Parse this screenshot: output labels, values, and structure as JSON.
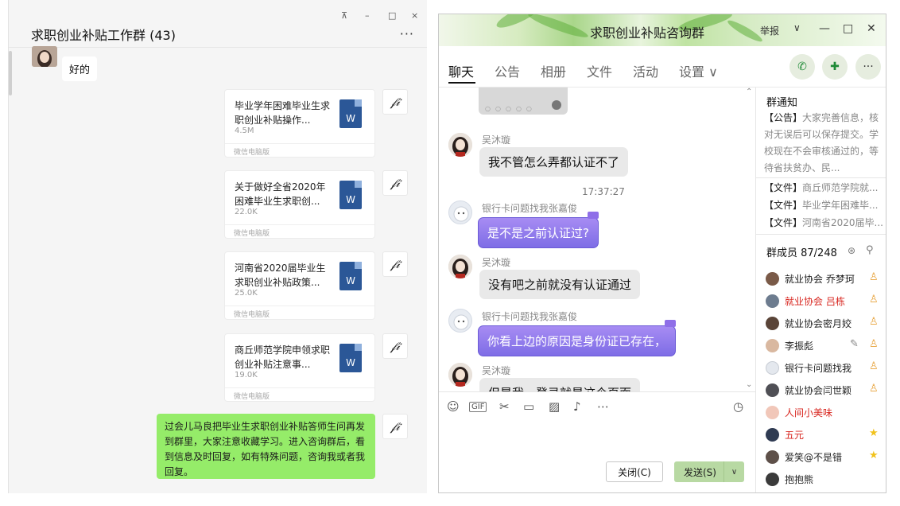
{
  "wechat": {
    "title": "求职创业补贴工作群 (43)",
    "controls": {
      "pin": "⊼",
      "minimize": "–",
      "maximize": "□",
      "close": "×"
    },
    "more": "···",
    "incoming_text": "好的",
    "files": [
      {
        "title": "毕业学年困难毕业生求职创业补贴操作...",
        "size": "4.5M",
        "source": "微信电脑版"
      },
      {
        "title": "关于做好全省2020年困难毕业生求职创...",
        "size": "22.0K",
        "source": "微信电脑版"
      },
      {
        "title": "河南省2020届毕业生求职创业补贴政策...",
        "size": "25.0K",
        "source": "微信电脑版"
      },
      {
        "title": "商丘师范学院申领求职创业补贴注意事...",
        "size": "19.0K",
        "source": "微信电脑版"
      }
    ],
    "word_icon_letter": "W",
    "avatar_glyph": "𝒻𝒾",
    "outgoing_text": "过会儿马良把毕业生求职创业补贴答师生问再发到群里，大家注意收藏学习。进入咨询群后，看到信息及时回复，如有特殊问题，咨询我或者我回复。"
  },
  "qq": {
    "title": "求职创业补贴咨询群",
    "title_controls": {
      "report": "举报",
      "dropdown": "∨",
      "minimize": "—",
      "maximize": "□",
      "close": "✕"
    },
    "tabs": [
      "聊天",
      "公告",
      "相册",
      "文件",
      "活动",
      "设置 ∨"
    ],
    "circle_buttons": {
      "call": "✆",
      "add": "✚",
      "more": "···"
    },
    "time": "17:37:27",
    "messages": [
      {
        "name": "吴沐璇",
        "text": "我不管怎么弄都认证不了"
      },
      {
        "name": "银行卡问题找我张嘉俊",
        "text": "是不是之前认证过?"
      },
      {
        "name": "吴沐璇",
        "text": "没有吧之前就没有认证通过"
      },
      {
        "name": "银行卡问题找我张嘉俊",
        "text": "你看上边的原因是身份证已存在，"
      },
      {
        "name": "吴沐璇",
        "text": "但是我一登录就是这个页面"
      }
    ],
    "toolbar_icons": [
      "☺",
      "GIF",
      "✂",
      "▭",
      "▨",
      "♪",
      "⋯",
      "◷"
    ],
    "close_label": "关闭(C)",
    "send_label": "发送(S)",
    "send_dropdown": "∨",
    "notice_header": "群通知",
    "notice_tag": "【公告】",
    "notice_text": "大家完善信息，核对无误后可以保存提交。学校现在不会审核通过的，等待省扶贫办、民...",
    "file_lines": [
      {
        "tag": "【文件】",
        "name": "商丘师范学院就..."
      },
      {
        "tag": "【文件】",
        "name": "毕业学年困难毕..."
      },
      {
        "tag": "【文件】",
        "name": "河南省2020届毕..."
      }
    ],
    "members_header": "群成员 87/248",
    "members": [
      {
        "name": "就业协会 乔梦珂",
        "red": false,
        "badge": "person"
      },
      {
        "name": "就业协会 吕栋",
        "red": true,
        "badge": "person-star"
      },
      {
        "name": "就业协会密月姣",
        "red": false,
        "badge": "person"
      },
      {
        "name": "李振彪",
        "red": false,
        "badge": "person"
      },
      {
        "name": "银行卡问题找我",
        "red": false,
        "badge": "person"
      },
      {
        "name": "就业协会闫世颖",
        "red": false,
        "badge": "person-star"
      },
      {
        "name": "人间小美味",
        "red": true,
        "badge": ""
      },
      {
        "name": "五元",
        "red": true,
        "badge": "star"
      },
      {
        "name": "爱笑@不是错",
        "red": false,
        "badge": "star"
      },
      {
        "name": "抱抱熊",
        "red": false,
        "badge": ""
      }
    ],
    "colors": {
      "send_green": "#b8d9a3",
      "purple_bubble": "#8f77ee",
      "red_name": "#d8261f"
    }
  }
}
